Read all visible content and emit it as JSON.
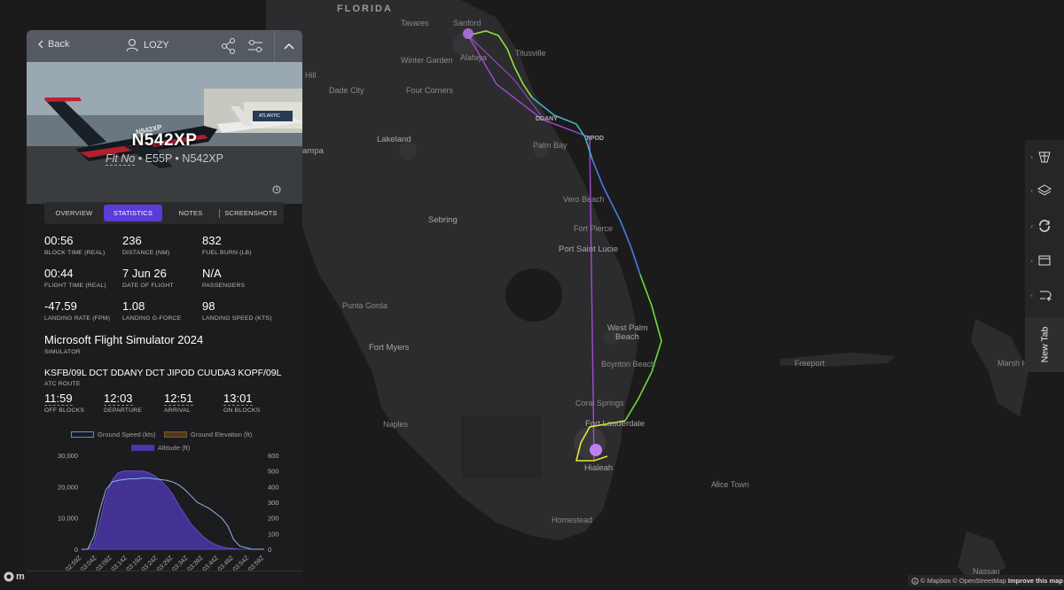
{
  "map": {
    "labels": {
      "florida": "FLORIDA",
      "tavares": "Tavares",
      "sanford": "Sanford",
      "titusville": "Titusville",
      "winter_garden": "Winter Garden",
      "alafaya": "Alafaya",
      "dade_city": "Dade City",
      "four_corners": "Four Corners",
      "hill": "Hill",
      "lakeland": "Lakeland",
      "palm_bay": "Palm Bay",
      "ampa": "ampa",
      "vero_beach": "Vero Beach",
      "sebring": "Sebring",
      "fort_pierce": "Fort Pierce",
      "port_saint_lucie": "Port Saint Lucie",
      "punta_gorda": "Punta Gorda",
      "fort_myers": "Fort Myers",
      "west_palm_beach_1": "West Palm",
      "west_palm_beach_2": "Beach",
      "boynton_beach": "Boynton Beach",
      "freeport": "Freeport",
      "marsh_harbour": "Marsh H",
      "coral_springs": "Coral Springs",
      "fort_lauderdale": "Fort Lauderdale",
      "naples": "Naples",
      "hialeah": "Hialeah",
      "alice_town": "Alice Town",
      "homestead": "Homestead",
      "nassau": "Nassau",
      "ddany": "DDANY",
      "jipod": "JIPOD"
    },
    "attribution": {
      "mapbox": "© Mapbox",
      "osm": "© OpenStreetMap",
      "improve": "Improve this map"
    },
    "logo_text": "m"
  },
  "panel": {
    "back_label": "Back",
    "username": "LOZY",
    "registration": "N542XP",
    "flt_no_label": "Flt No",
    "aircraft_type": "E55P",
    "separator": "•",
    "callsign": "N542XP",
    "tabs": [
      "OVERVIEW",
      "STATISTICS",
      "NOTES",
      "SCREENSHOTS"
    ],
    "active_tab": "STATISTICS",
    "stats": [
      {
        "value": "00:56",
        "label": "BLOCK TIME (REAL)"
      },
      {
        "value": "236",
        "label": "DISTANCE (NM)"
      },
      {
        "value": "832",
        "label": "FUEL BURN (LB)"
      },
      {
        "value": "00:44",
        "label": "FLIGHT TIME (REAL)"
      },
      {
        "value": "7 Jun 26",
        "label": "DATE OF FLIGHT"
      },
      {
        "value": "N/A",
        "label": "PASSENGERS"
      },
      {
        "value": "-47.59",
        "label": "LANDING RATE (FPM)"
      },
      {
        "value": "1.08",
        "label": "LANDING G-FORCE"
      },
      {
        "value": "98",
        "label": "LANDING SPEED (KTS)"
      }
    ],
    "simulator": {
      "value": "Microsoft Flight Simulator 2024",
      "label": "SIMULATOR"
    },
    "route": {
      "value": "KSFB/09L DCT DDANY DCT JIPOD CUUDA3 KOPF/09L",
      "label": "ATC ROUTE"
    },
    "times": [
      {
        "value": "11:59",
        "label": "OFF BLOCKS"
      },
      {
        "value": "12:03",
        "label": "DEPARTURE"
      },
      {
        "value": "12:51",
        "label": "ARRIVAL"
      },
      {
        "value": "13:01",
        "label": "ON BLOCKS"
      }
    ],
    "hero_plane_reg": "N542XP",
    "hero_sign": "ATLANTIC"
  },
  "colors": {
    "accent": "#5b3bd9",
    "ground_speed": "#5b8fd6",
    "ground_elevation": "#7a5a2a",
    "altitude": "#4a36a8"
  },
  "chart_data": {
    "type": "area",
    "series": [
      {
        "name": "Ground Speed (kts)",
        "axis": "right"
      },
      {
        "name": "Ground Elevation (ft)",
        "axis": "left"
      },
      {
        "name": "Altitude (ft)",
        "axis": "left"
      }
    ],
    "left_ticks": [
      "30,000",
      "20,000",
      "10,000",
      "0"
    ],
    "right_ticks": [
      "600",
      "500",
      "400",
      "300",
      "200",
      "100",
      "0"
    ],
    "x_ticks": [
      "02:59Z",
      "03:04Z",
      "03:09Z",
      "03:14Z",
      "03:19Z",
      "03:24Z",
      "03:29Z",
      "03:34Z",
      "03:39Z",
      "03:44Z",
      "03:49Z",
      "03:54Z",
      "03:59Z"
    ],
    "ylim_left": [
      0,
      30000
    ],
    "ylim_right": [
      0,
      600
    ],
    "x_minutes": [
      0,
      2,
      4,
      6,
      8,
      10,
      12,
      14,
      16,
      18,
      20,
      22,
      24,
      26,
      28,
      30,
      32,
      34,
      36,
      38,
      40,
      42,
      44,
      46,
      48,
      50,
      52,
      54,
      56,
      58,
      60
    ],
    "altitude": [
      0,
      0,
      2000,
      9000,
      17000,
      22000,
      24500,
      25000,
      25000,
      25000,
      25000,
      24500,
      23500,
      22000,
      20000,
      17500,
      14000,
      11000,
      8000,
      6000,
      4000,
      2500,
      1500,
      800,
      400,
      200,
      0,
      0,
      0,
      0,
      0
    ],
    "ground_speed": [
      0,
      0,
      80,
      250,
      380,
      430,
      440,
      445,
      450,
      450,
      455,
      455,
      450,
      445,
      440,
      430,
      410,
      380,
      340,
      300,
      280,
      260,
      230,
      200,
      150,
      60,
      20,
      10,
      0,
      0,
      0
    ],
    "ground_elevation": [
      0,
      0,
      0,
      0,
      0,
      0,
      0,
      0,
      0,
      0,
      0,
      0,
      0,
      0,
      0,
      0,
      0,
      0,
      0,
      0,
      0,
      0,
      0,
      0,
      0,
      0,
      0,
      0,
      0,
      0,
      0
    ]
  }
}
